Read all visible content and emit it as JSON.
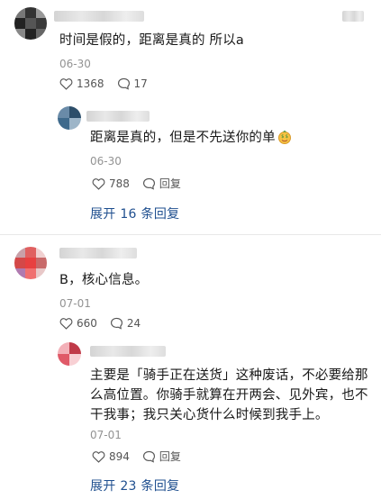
{
  "comments": [
    {
      "text": "时间是假的，距离是真的 所以a",
      "date": "06-30",
      "likes": "1368",
      "replies": "17",
      "reply": {
        "text": "距离是真的，但是不先送你的单",
        "date": "06-30",
        "likes": "788",
        "reply_label": "回复"
      },
      "expand": "展开 16 条回复"
    },
    {
      "text": "B，核心信息。",
      "date": "07-01",
      "likes": "660",
      "replies": "24",
      "reply": {
        "text_line1": "主要是「骑手正在送货」这种废话，不必要给那",
        "text_line2": "么高位置。你骑手就算在开两会、见外宾，也不",
        "text_line3": "干我事；我只关心货什么时候到我手上。",
        "date": "07-01",
        "likes": "894",
        "reply_label": "回复"
      },
      "expand": "展开 23 条回复"
    }
  ],
  "colors": {
    "link": "#1f4f8f",
    "muted": "#939393"
  },
  "icons": {
    "like": "heart-outline-icon",
    "comment": "speech-bubble-icon",
    "emoji": "money-face-emoji-icon"
  }
}
